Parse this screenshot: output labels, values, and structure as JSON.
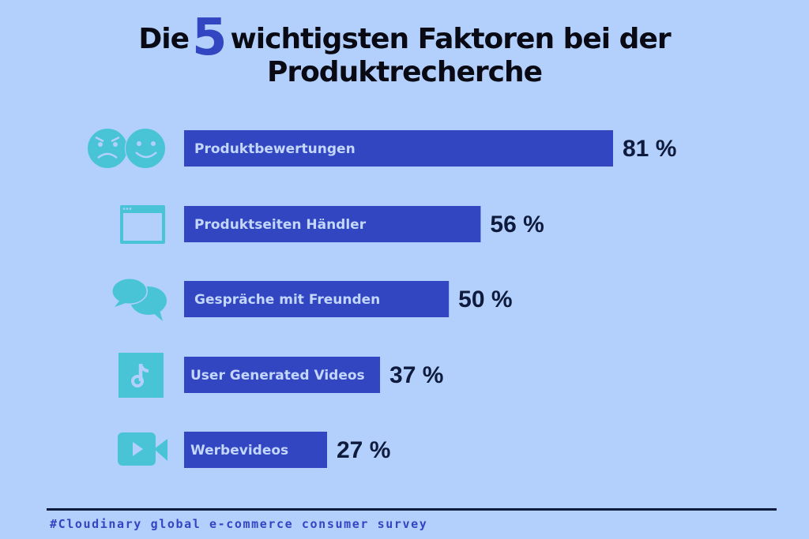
{
  "title": {
    "prefix": "Die",
    "highlight": "5",
    "suffix": "wichtigsten Faktoren bei der",
    "line2": "Produktrecherche"
  },
  "colors": {
    "background": "#b3d0fc",
    "bar": "#3346c2",
    "icon": "#48c4d6",
    "bar_text": "#c3d7fb",
    "value_text": "#0f1b3d"
  },
  "chart_data": {
    "type": "bar",
    "orientation": "horizontal",
    "title": "Die 5 wichtigsten Faktoren bei der Produktrecherche",
    "categories": [
      "Produktbewertungen",
      "Produktseiten Händler",
      "Gespräche mit Freunden",
      "User Generated Videos",
      "Werbevideos"
    ],
    "values": [
      81,
      56,
      50,
      37,
      27
    ],
    "value_labels": [
      "81 %",
      "56 %",
      "50 %",
      "37 %",
      "27 %"
    ],
    "icons": [
      "faces-icon",
      "browser-window-icon",
      "speech-bubbles-icon",
      "tiktok-icon",
      "video-camera-icon"
    ],
    "xlabel": "",
    "ylabel": "",
    "xlim": [
      0,
      100
    ],
    "unit": "%",
    "grid": false,
    "legend": "none"
  },
  "footer": {
    "source": "#Cloudinary global e-commerce consumer survey"
  }
}
